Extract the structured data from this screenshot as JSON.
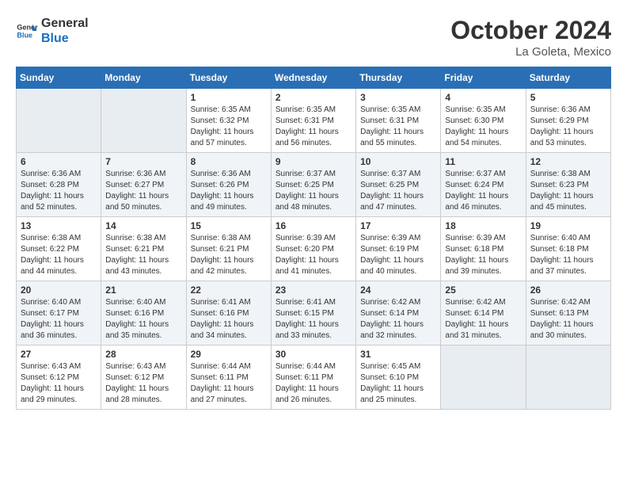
{
  "header": {
    "logo_line1": "General",
    "logo_line2": "Blue",
    "month_title": "October 2024",
    "location": "La Goleta, Mexico"
  },
  "weekdays": [
    "Sunday",
    "Monday",
    "Tuesday",
    "Wednesday",
    "Thursday",
    "Friday",
    "Saturday"
  ],
  "weeks": [
    [
      {
        "day": "",
        "sunrise": "",
        "sunset": "",
        "daylight": "",
        "empty": true
      },
      {
        "day": "",
        "sunrise": "",
        "sunset": "",
        "daylight": "",
        "empty": true
      },
      {
        "day": "1",
        "sunrise": "Sunrise: 6:35 AM",
        "sunset": "Sunset: 6:32 PM",
        "daylight": "Daylight: 11 hours and 57 minutes.",
        "empty": false
      },
      {
        "day": "2",
        "sunrise": "Sunrise: 6:35 AM",
        "sunset": "Sunset: 6:31 PM",
        "daylight": "Daylight: 11 hours and 56 minutes.",
        "empty": false
      },
      {
        "day": "3",
        "sunrise": "Sunrise: 6:35 AM",
        "sunset": "Sunset: 6:31 PM",
        "daylight": "Daylight: 11 hours and 55 minutes.",
        "empty": false
      },
      {
        "day": "4",
        "sunrise": "Sunrise: 6:35 AM",
        "sunset": "Sunset: 6:30 PM",
        "daylight": "Daylight: 11 hours and 54 minutes.",
        "empty": false
      },
      {
        "day": "5",
        "sunrise": "Sunrise: 6:36 AM",
        "sunset": "Sunset: 6:29 PM",
        "daylight": "Daylight: 11 hours and 53 minutes.",
        "empty": false
      }
    ],
    [
      {
        "day": "6",
        "sunrise": "Sunrise: 6:36 AM",
        "sunset": "Sunset: 6:28 PM",
        "daylight": "Daylight: 11 hours and 52 minutes.",
        "empty": false
      },
      {
        "day": "7",
        "sunrise": "Sunrise: 6:36 AM",
        "sunset": "Sunset: 6:27 PM",
        "daylight": "Daylight: 11 hours and 50 minutes.",
        "empty": false
      },
      {
        "day": "8",
        "sunrise": "Sunrise: 6:36 AM",
        "sunset": "Sunset: 6:26 PM",
        "daylight": "Daylight: 11 hours and 49 minutes.",
        "empty": false
      },
      {
        "day": "9",
        "sunrise": "Sunrise: 6:37 AM",
        "sunset": "Sunset: 6:25 PM",
        "daylight": "Daylight: 11 hours and 48 minutes.",
        "empty": false
      },
      {
        "day": "10",
        "sunrise": "Sunrise: 6:37 AM",
        "sunset": "Sunset: 6:25 PM",
        "daylight": "Daylight: 11 hours and 47 minutes.",
        "empty": false
      },
      {
        "day": "11",
        "sunrise": "Sunrise: 6:37 AM",
        "sunset": "Sunset: 6:24 PM",
        "daylight": "Daylight: 11 hours and 46 minutes.",
        "empty": false
      },
      {
        "day": "12",
        "sunrise": "Sunrise: 6:38 AM",
        "sunset": "Sunset: 6:23 PM",
        "daylight": "Daylight: 11 hours and 45 minutes.",
        "empty": false
      }
    ],
    [
      {
        "day": "13",
        "sunrise": "Sunrise: 6:38 AM",
        "sunset": "Sunset: 6:22 PM",
        "daylight": "Daylight: 11 hours and 44 minutes.",
        "empty": false
      },
      {
        "day": "14",
        "sunrise": "Sunrise: 6:38 AM",
        "sunset": "Sunset: 6:21 PM",
        "daylight": "Daylight: 11 hours and 43 minutes.",
        "empty": false
      },
      {
        "day": "15",
        "sunrise": "Sunrise: 6:38 AM",
        "sunset": "Sunset: 6:21 PM",
        "daylight": "Daylight: 11 hours and 42 minutes.",
        "empty": false
      },
      {
        "day": "16",
        "sunrise": "Sunrise: 6:39 AM",
        "sunset": "Sunset: 6:20 PM",
        "daylight": "Daylight: 11 hours and 41 minutes.",
        "empty": false
      },
      {
        "day": "17",
        "sunrise": "Sunrise: 6:39 AM",
        "sunset": "Sunset: 6:19 PM",
        "daylight": "Daylight: 11 hours and 40 minutes.",
        "empty": false
      },
      {
        "day": "18",
        "sunrise": "Sunrise: 6:39 AM",
        "sunset": "Sunset: 6:18 PM",
        "daylight": "Daylight: 11 hours and 39 minutes.",
        "empty": false
      },
      {
        "day": "19",
        "sunrise": "Sunrise: 6:40 AM",
        "sunset": "Sunset: 6:18 PM",
        "daylight": "Daylight: 11 hours and 37 minutes.",
        "empty": false
      }
    ],
    [
      {
        "day": "20",
        "sunrise": "Sunrise: 6:40 AM",
        "sunset": "Sunset: 6:17 PM",
        "daylight": "Daylight: 11 hours and 36 minutes.",
        "empty": false
      },
      {
        "day": "21",
        "sunrise": "Sunrise: 6:40 AM",
        "sunset": "Sunset: 6:16 PM",
        "daylight": "Daylight: 11 hours and 35 minutes.",
        "empty": false
      },
      {
        "day": "22",
        "sunrise": "Sunrise: 6:41 AM",
        "sunset": "Sunset: 6:16 PM",
        "daylight": "Daylight: 11 hours and 34 minutes.",
        "empty": false
      },
      {
        "day": "23",
        "sunrise": "Sunrise: 6:41 AM",
        "sunset": "Sunset: 6:15 PM",
        "daylight": "Daylight: 11 hours and 33 minutes.",
        "empty": false
      },
      {
        "day": "24",
        "sunrise": "Sunrise: 6:42 AM",
        "sunset": "Sunset: 6:14 PM",
        "daylight": "Daylight: 11 hours and 32 minutes.",
        "empty": false
      },
      {
        "day": "25",
        "sunrise": "Sunrise: 6:42 AM",
        "sunset": "Sunset: 6:14 PM",
        "daylight": "Daylight: 11 hours and 31 minutes.",
        "empty": false
      },
      {
        "day": "26",
        "sunrise": "Sunrise: 6:42 AM",
        "sunset": "Sunset: 6:13 PM",
        "daylight": "Daylight: 11 hours and 30 minutes.",
        "empty": false
      }
    ],
    [
      {
        "day": "27",
        "sunrise": "Sunrise: 6:43 AM",
        "sunset": "Sunset: 6:12 PM",
        "daylight": "Daylight: 11 hours and 29 minutes.",
        "empty": false
      },
      {
        "day": "28",
        "sunrise": "Sunrise: 6:43 AM",
        "sunset": "Sunset: 6:12 PM",
        "daylight": "Daylight: 11 hours and 28 minutes.",
        "empty": false
      },
      {
        "day": "29",
        "sunrise": "Sunrise: 6:44 AM",
        "sunset": "Sunset: 6:11 PM",
        "daylight": "Daylight: 11 hours and 27 minutes.",
        "empty": false
      },
      {
        "day": "30",
        "sunrise": "Sunrise: 6:44 AM",
        "sunset": "Sunset: 6:11 PM",
        "daylight": "Daylight: 11 hours and 26 minutes.",
        "empty": false
      },
      {
        "day": "31",
        "sunrise": "Sunrise: 6:45 AM",
        "sunset": "Sunset: 6:10 PM",
        "daylight": "Daylight: 11 hours and 25 minutes.",
        "empty": false
      },
      {
        "day": "",
        "sunrise": "",
        "sunset": "",
        "daylight": "",
        "empty": true
      },
      {
        "day": "",
        "sunrise": "",
        "sunset": "",
        "daylight": "",
        "empty": true
      }
    ]
  ]
}
